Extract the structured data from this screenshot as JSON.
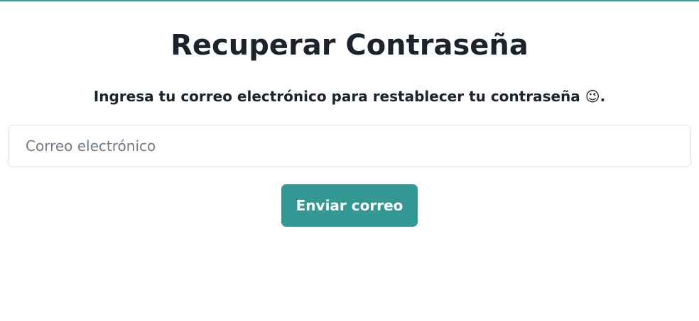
{
  "page": {
    "title": "Recuperar Contraseña",
    "subtitle": "Ingresa tu correo electrónico para restablecer tu contraseña",
    "subtitle_emoji": "😉",
    "subtitle_end": "."
  },
  "form": {
    "email_placeholder": "Correo electrónico",
    "email_value": "",
    "submit_label": "Enviar correo"
  },
  "colors": {
    "accent": "#339893",
    "text": "#1c232c",
    "placeholder": "#6f7a88",
    "input_border": "#dfe3e8"
  },
  "icons": {
    "subtitle_emoji": "winking-face-emoji-icon"
  }
}
